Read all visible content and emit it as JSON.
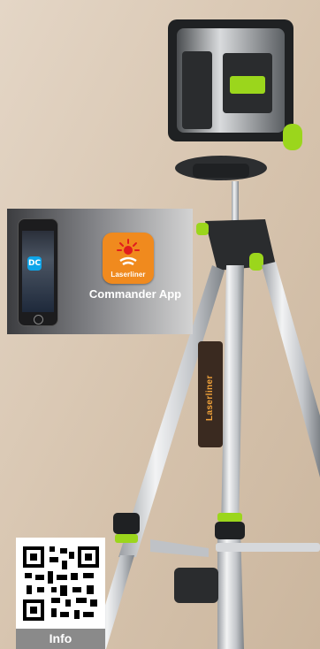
{
  "promo": {
    "app_name": "Commander App",
    "app_icon_label": "Laserliner"
  },
  "tripod": {
    "brand_label": "Laserliner"
  },
  "info": {
    "label": "Info"
  },
  "colors": {
    "background": "#d7c6b2",
    "accent_green": "#9bd61c",
    "app_orange": "#f08a1e",
    "info_gray": "#8a8a8a"
  },
  "icons": [
    "phone-icon",
    "app-icon",
    "qr-code-icon"
  ]
}
